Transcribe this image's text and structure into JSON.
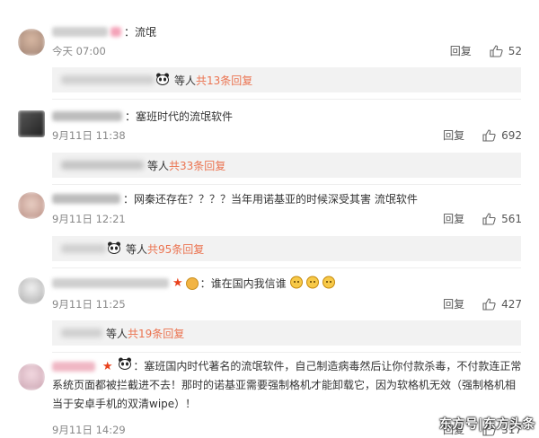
{
  "comments": [
    {
      "text": "：流氓",
      "time": "今天 07:00",
      "reply_label": "回复",
      "likes": "52"
    },
    {
      "text": "：塞班时代的流氓软件",
      "time": "9月11日 11:38",
      "reply_label": "回复",
      "likes": "692",
      "sub": {
        "suffix": "等人",
        "link": "共33条回复"
      }
    },
    {
      "text": "：网秦还存在？？？？当年用诺基亚的时候深受其害 流氓软件",
      "time": "9月11日 12:21",
      "reply_label": "回复",
      "likes": "561",
      "sub": {
        "suffix": "等人",
        "link": "共95条回复"
      }
    },
    {
      "text": "：谁在国内我信谁",
      "time": "9月11日 11:25",
      "reply_label": "回复",
      "likes": "427",
      "sub": {
        "suffix": "等人",
        "link": "共19条回复"
      }
    },
    {
      "text": "：塞班国内时代著名的流氓软件，自己制造病毒然后让你付款杀毒，不付款连正常系统页面都被拦截进不去！那时的诺基亚需要强制格机才能卸载它，因为软格机无效（强制格机相当于安卓手机的双清wipe）！",
      "time": "9月11日 14:29",
      "reply_label": "回复",
      "likes": "317"
    }
  ],
  "first_sub": {
    "suffix": "等人",
    "link": "共13条回复"
  },
  "watermark": "东方号|东方头条",
  "colors": {
    "link": "#eb7350",
    "star": "#e9411c",
    "subbox_bg": "#f2f2f2"
  }
}
